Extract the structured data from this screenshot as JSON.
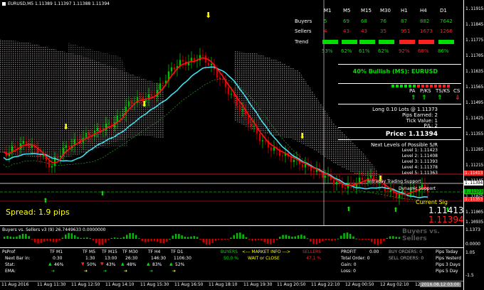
{
  "chart": {
    "symbol_header": "EURUSD,M5  1.11389 1.11397 1.11388 1.11394"
  },
  "y_axis": {
    "labels": [
      "1.11915",
      "1.11845",
      "1.11775",
      "1.11705",
      "1.11635",
      "1.11565",
      "1.11495",
      "1.11425",
      "1.11355",
      "1.11285",
      "1.11215",
      "1.11145",
      "1.11075",
      "1.11005",
      "1.10935"
    ],
    "tags": {
      "red_top": "1.11413",
      "white": "1.11394",
      "green": "1.11373",
      "red_bottom": "1.11353"
    },
    "sub1_labels": [
      "1.1373",
      "0.0000"
    ],
    "sub2_labels": [
      "1.05",
      "-1.5"
    ]
  },
  "x_axis": {
    "labels": [
      "11 Aug 2016",
      "11 Aug 11:30",
      "11 Aug 12:50",
      "11 Aug 14:10",
      "11 Aug 15:30",
      "11 Aug 16:50",
      "11 Aug 18:10",
      "11 Aug 19:30",
      "11 Aug 20:50",
      "11 Aug 22:10",
      "12 Aug 00:50",
      "12 Aug 02:10",
      "12 Aug 03:30"
    ],
    "cursor_label": "2016.08.12 03:00"
  },
  "table": {
    "timeframes": [
      "M1",
      "M5",
      "M15",
      "M30",
      "H1",
      "H4",
      "D1"
    ],
    "buyers_label": "Buyers",
    "sellers_label": "Sellers",
    "trend_label": "Trend",
    "buyers": [
      "5",
      "69",
      "68",
      "76",
      "87",
      "882",
      "7642"
    ],
    "sellers": [
      "4",
      "43",
      "43",
      "35",
      "951",
      "1673",
      "1266"
    ],
    "trend_colors": [
      "#00e000",
      "#00e000",
      "#00e000",
      "#00e000",
      "#ff2020",
      "#ff2020",
      "#00e000"
    ],
    "percents": [
      "53%",
      "62%",
      "61%",
      "62%",
      "92%",
      "68%",
      "86%"
    ],
    "percent_colors": [
      "#00e000",
      "#00e000",
      "#00e000",
      "#00e000",
      "#ff2020",
      "#ff2020",
      "#00e000"
    ]
  },
  "info": {
    "bullish": "40% Bullish (MS): EURUSD",
    "signals": [
      "PA",
      "P/KS",
      "TS/KS",
      "CS"
    ],
    "signal_arrows": [
      "up",
      "up",
      "up",
      "down"
    ],
    "lots": "Long 0.10 Lots @ 1.11373",
    "pips_earned": "Pips Earned: 2",
    "tick_value": "Tick Value: 1",
    "pl": "P/L: 2",
    "price": "Price: 1.11394",
    "levels_title": "Next Levels of Possible S/R",
    "levels": [
      "Level 1: 1.11423",
      "Level 2: 1.11408",
      "Level 3: 1.11393",
      "Level 4: 1.11378",
      "Level 5: 1.11363"
    ],
    "trading_support": "Intraday Trading Support",
    "dynamic_support": "Dynamic Support",
    "current_sig": "Current Sig",
    "big_price_white": "1.11413",
    "big_price_red": "1.11394"
  },
  "spread": "Spread: 1.9 pips",
  "sub1": {
    "title": "Buyers vs. Sellers v3 (9) 26.7449633 0.0000000",
    "watermark": "Buyers vs. Sellers"
  },
  "sub2": {
    "title": "PsProf",
    "next_bar": "Next Bar in:",
    "stat_label": "Stat:",
    "ema_label": "EMA:",
    "tfs": [
      "TF M1",
      "TF M5",
      "TF M15",
      "TF M30",
      "TF H4",
      "TF D1"
    ],
    "times": [
      "0:30",
      "1:30",
      "13:00",
      "26:30",
      "146:30",
      "1106:30"
    ],
    "stat_pcts": [
      "46%",
      "50%",
      "43%",
      "48%",
      "83%",
      "52%"
    ],
    "stat_colors": [
      "#00e000",
      "#ff2020",
      "#ff2020",
      "#00e000",
      "#00e000",
      "#00e000"
    ],
    "buyers_label": "BUYERS",
    "buyers_pct": "50.0 %",
    "market_info": "<--- MARKET INFO --->",
    "wait_close": "WAIT or CLOSE",
    "sellers_label": "SELLERS",
    "sellers_pct": "47.1 %",
    "profit_label": "PROFIT",
    "profit_value": "0.00",
    "total_order": "Total Order: 0",
    "gain": "Gain: 0",
    "loss": "Loss: 0",
    "buy_orders": "BUY ORDERS:  0",
    "sell_orders": "SELL ORDERS: 0",
    "pips_today": "Pips Today",
    "pips_yesterday": "Pips Yesterd",
    "pips_3": "Pips 3 Days",
    "pips_5": "Pips 5 Day"
  },
  "colors": {
    "cyan": "#40e0f0",
    "red_line": "#ff1010",
    "candle_up": "#00c000",
    "candle_down": "#d00000",
    "cloud": "#c8c0c0"
  }
}
